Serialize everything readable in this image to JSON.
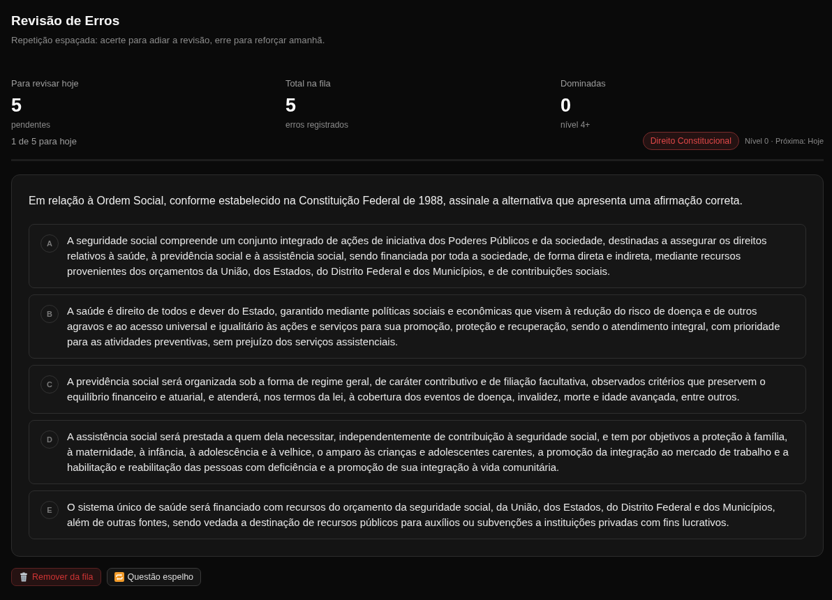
{
  "header": {
    "title": "Revisão de Erros",
    "subtitle": "Repetição espaçada: acerte para adiar a revisão, erre para reforçar amanhã."
  },
  "stats": [
    {
      "label": "Para revisar hoje",
      "value": "5",
      "caption": "pendentes"
    },
    {
      "label": "Total na fila",
      "value": "5",
      "caption": "erros registrados"
    },
    {
      "label": "Dominadas",
      "value": "0",
      "caption": "nível 4+"
    }
  ],
  "progress": "1 de 5 para hoje",
  "tag": "Direito Constitucional",
  "schedule": "Nível 0 · Próxima: Hoje",
  "question": {
    "text": "Em relação à Ordem Social, conforme estabelecido na Constituição Federal de 1988, assinale a alternativa que apresenta uma afirmação correta.",
    "options": [
      {
        "letter": "A",
        "text": "A seguridade social compreende um conjunto integrado de ações de iniciativa dos Poderes Públicos e da sociedade, destinadas a assegurar os direitos relativos à saúde, à previdência social e à assistência social, sendo financiada por toda a sociedade, de forma direta e indireta, mediante recursos provenientes dos orçamentos da União, dos Estados, do Distrito Federal e dos Municípios, e de contribuições sociais.",
        "selected": false
      },
      {
        "letter": "B",
        "text": "A saúde é direito de todos e dever do Estado, garantido mediante políticas sociais e econômicas que visem à redução do risco de doença e de outros agravos e ao acesso universal e igualitário às ações e serviços para sua promoção, proteção e recuperação, sendo o atendimento integral, com prioridade para as atividades preventivas, sem prejuízo dos serviços assistenciais.",
        "selected": false
      },
      {
        "letter": "C",
        "text": "A previdência social será organizada sob a forma de regime geral, de caráter contributivo e de filiação facultativa, observados critérios que preservem o equilíbrio financeiro e atuarial, e atenderá, nos termos da lei, à cobertura dos eventos de doença, invalidez, morte e idade avançada, entre outros.",
        "selected": false
      },
      {
        "letter": "D",
        "text": "A assistência social será prestada a quem dela necessitar, independentemente de contribuição à seguridade social, e tem por objetivos a proteção à família, à maternidade, à infância, à adolescência e à velhice, o amparo às crianças e adolescentes carentes, a promoção da integração ao mercado de trabalho e a habilitação e reabilitação das pessoas com deficiência e a promoção de sua integração à vida comunitária.",
        "selected": false
      },
      {
        "letter": "E",
        "text": "O sistema único de saúde será financiado com recursos do orçamento da seguridade social, da União, dos Estados, do Distrito Federal e dos Municípios, além de outras fontes, sendo vedada a destinação de recursos públicos para auxílios ou subvenções a instituições privadas com fins lucrativos.",
        "selected": false
      }
    ]
  },
  "actions": [
    {
      "label": "Remover da fila",
      "kind": "danger"
    },
    {
      "label": "Questão espelho",
      "kind": "mirror"
    }
  ]
}
